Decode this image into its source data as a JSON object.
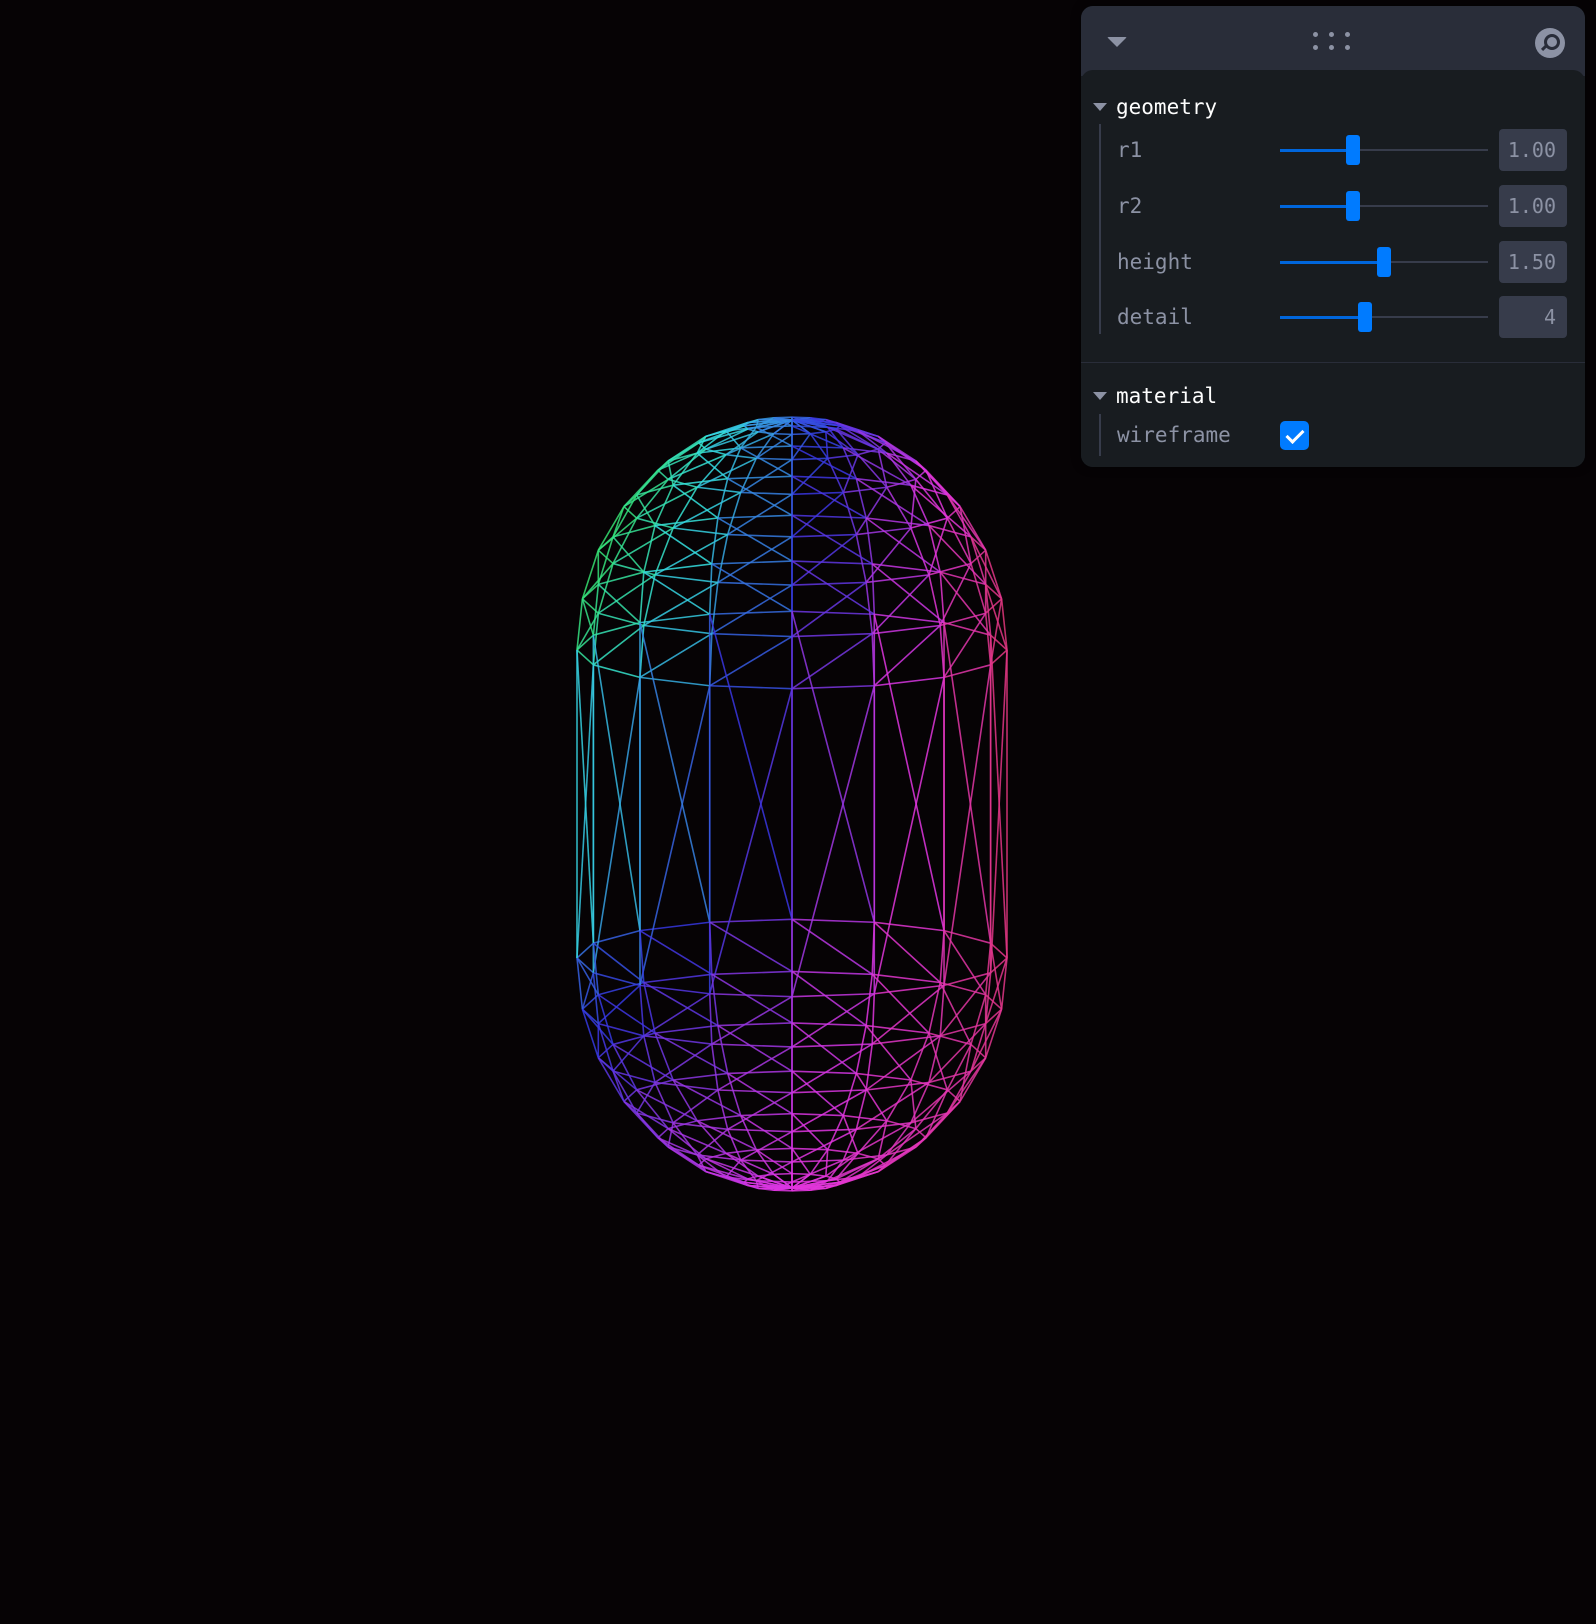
{
  "scene": {
    "background": "#060305",
    "object": "capsule-wireframe"
  },
  "panel": {
    "header": {
      "collapse_icon": "chevron-down-icon",
      "drag_icon": "drag-handle-icon",
      "search_icon": "search-icon"
    },
    "folders": [
      {
        "title": "geometry",
        "controls": [
          {
            "label": "r1",
            "value": "1.00",
            "fraction": 0.35
          },
          {
            "label": "r2",
            "value": "1.00",
            "fraction": 0.35
          },
          {
            "label": "height",
            "value": "1.50",
            "fraction": 0.5
          },
          {
            "label": "detail",
            "value": "4",
            "fraction": 0.41
          }
        ]
      },
      {
        "title": "material",
        "controls": [
          {
            "label": "wireframe",
            "checked": true
          }
        ]
      }
    ]
  },
  "colors": {
    "accent": "#007bff",
    "panel_bg": "#181c20",
    "header_bg": "#292d39",
    "field_bg": "#373c4b",
    "label": "#8c92a4",
    "title": "#fefefe"
  }
}
